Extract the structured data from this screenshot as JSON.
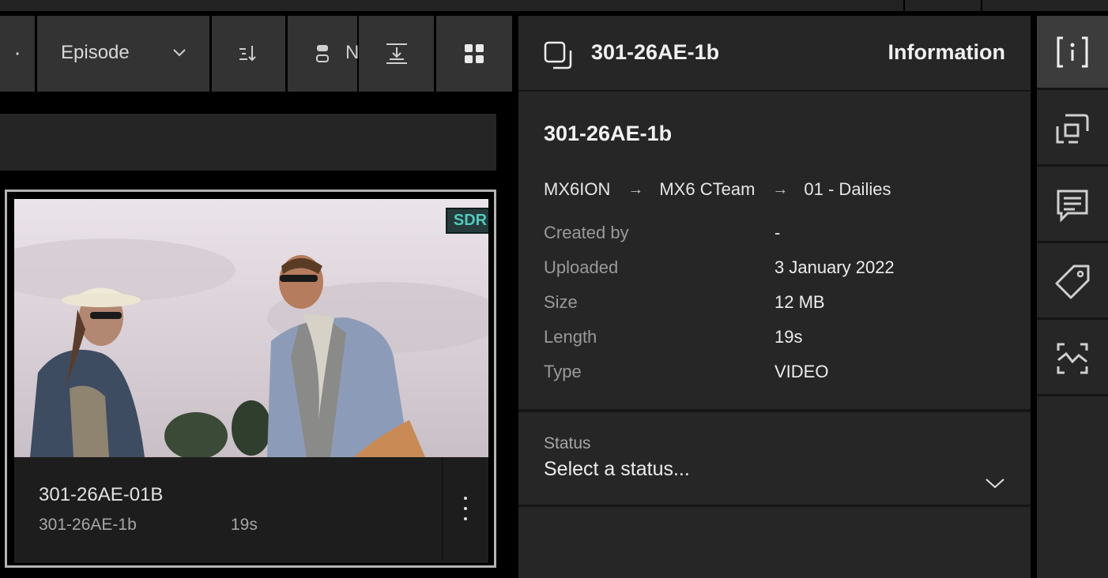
{
  "toolbar": {
    "group_by_value": "Episode",
    "truncated_label": "N"
  },
  "card": {
    "badge": "SDR",
    "title": "301-26AE-01B",
    "subtitle": "301-26AE-1b",
    "length": "19s"
  },
  "info": {
    "header_title": "301-26AE-1b",
    "header_label": "Information",
    "asset_name": "301-26AE-1b",
    "breadcrumb": [
      "MX6ION",
      "MX6 CTeam",
      "01 - Dailies"
    ],
    "breadcrumb_separator": "→",
    "meta": [
      {
        "key": "Created by",
        "value": "-"
      },
      {
        "key": "Uploaded",
        "value": "3 January 2022"
      },
      {
        "key": "Size",
        "value": "12 MB"
      },
      {
        "key": "Length",
        "value": "19s"
      },
      {
        "key": "Type",
        "value": "VIDEO"
      }
    ],
    "status_label": "Status",
    "status_placeholder": "Select a status..."
  },
  "rail": {
    "items": [
      {
        "icon": "info-icon",
        "active": true
      },
      {
        "icon": "frame-icon",
        "active": false
      },
      {
        "icon": "comment-icon",
        "active": false
      },
      {
        "icon": "tag-icon",
        "active": false
      },
      {
        "icon": "scan-icon",
        "active": false
      }
    ]
  },
  "colors": {
    "panel": "#262626",
    "toolbar_button": "#333333",
    "badge_text": "#52c9bd",
    "badge_bg": "#253a3a"
  }
}
